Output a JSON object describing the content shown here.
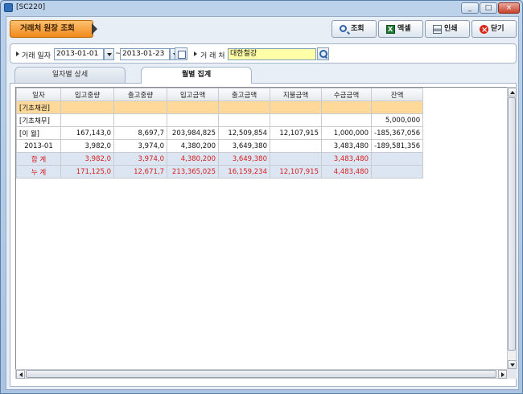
{
  "window": {
    "title": "[SC220]"
  },
  "header": {
    "screen_title": "거래처 원장 조회"
  },
  "toolbar": {
    "search_label": "조회",
    "excel_label": "액셀",
    "print_label": "인쇄",
    "close_label": "닫기"
  },
  "conditions": {
    "date_label": "거래 일자",
    "date_from": "2013-01-01",
    "range_sep": "~",
    "date_to": "2013-01-23",
    "customer_label": "거 래 처",
    "customer_value": "대한철강"
  },
  "tabs": [
    {
      "label": "일자별 상세",
      "active": false
    },
    {
      "label": "월별 집계",
      "active": true
    }
  ],
  "grid": {
    "columns": [
      "일자",
      "입고중량",
      "출고중량",
      "입고금액",
      "출고금액",
      "지불금액",
      "수금금액",
      "잔액"
    ],
    "rows": [
      {
        "type": "carry",
        "cells": [
          "[기초채권]",
          "",
          "",
          "",
          "",
          "",
          "",
          ""
        ]
      },
      {
        "type": "normal",
        "cells": [
          "[기초채무]",
          "",
          "",
          "",
          "",
          "",
          "",
          "5,000,000"
        ]
      },
      {
        "type": "normal",
        "cells": [
          "[이    월]",
          "167,143,0",
          "8,697,7",
          "203,984,825",
          "12,509,854",
          "12,107,915",
          "1,000,000",
          "-185,367,056"
        ]
      },
      {
        "type": "normal",
        "cells": [
          "2013-01",
          "3,982,0",
          "3,974,0",
          "4,380,200",
          "3,649,380",
          "",
          "3,483,480",
          "-189,581,356"
        ]
      },
      {
        "type": "total",
        "cells": [
          "합  계",
          "3,982,0",
          "3,974,0",
          "4,380,200",
          "3,649,380",
          "",
          "3,483,480",
          ""
        ]
      },
      {
        "type": "cum",
        "cells": [
          "누  계",
          "171,125,0",
          "12,671,7",
          "213,365,025",
          "16,159,234",
          "12,107,915",
          "4,483,480",
          ""
        ]
      }
    ]
  },
  "colors": {
    "title_orange": "#f08a1c",
    "carry_row": "#ffd99a",
    "total_row_bg": "#dce6f2",
    "total_row_text": "#d71d1d",
    "customer_field": "#ffffa8"
  }
}
